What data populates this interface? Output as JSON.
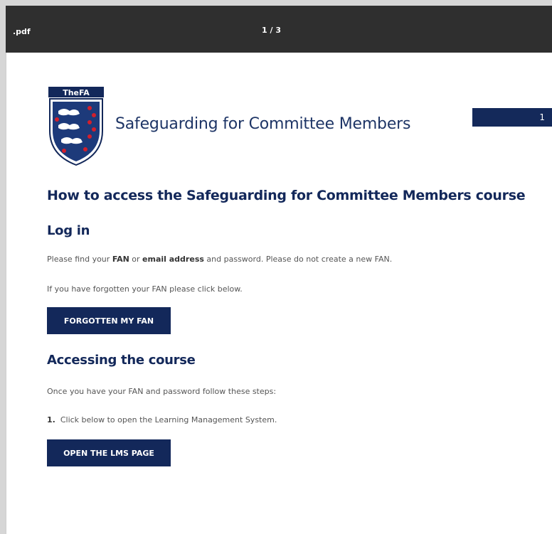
{
  "viewer": {
    "filename": ".pdf",
    "page_indicator": "1 / 3"
  },
  "document": {
    "logo_text": "TheFA",
    "title": "Safeguarding for Committee Members",
    "page_tab": "1",
    "heading": "How to access the Safeguarding for Committee Members course",
    "login": {
      "heading": "Log in",
      "text_pre": "Please find your ",
      "text_fan": "FAN",
      "text_mid": " or ",
      "text_email": "email address",
      "text_post": " and password. Please do not create a new FAN.",
      "forgotten_text": "If you have forgotten your FAN please click below.",
      "forgotten_button": "FORGOTTEN MY FAN"
    },
    "course": {
      "heading": "Accessing the course",
      "intro": "Once you have your FAN and password follow these steps:",
      "step_number": "1.",
      "step_text": "Click below to open the Learning Management System.",
      "lms_button": "OPEN THE LMS PAGE"
    }
  },
  "colors": {
    "navy": "#13285a",
    "toolbar": "#2f2f2f"
  }
}
